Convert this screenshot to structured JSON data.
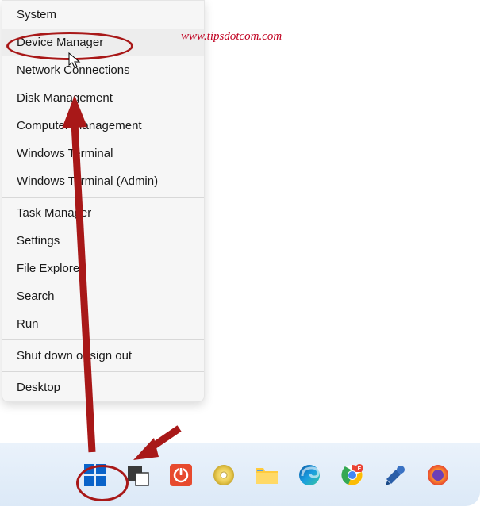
{
  "watermark": "www.tipsdotcom.com",
  "menu": {
    "items": [
      {
        "label": "System"
      },
      {
        "label": "Device Manager",
        "hover": true
      },
      {
        "label": "Network Connections"
      },
      {
        "label": "Disk Management"
      },
      {
        "label": "Computer Management"
      },
      {
        "label": "Windows Terminal"
      },
      {
        "label": "Windows Terminal (Admin)"
      }
    ],
    "items2": [
      {
        "label": "Task Manager"
      },
      {
        "label": "Settings"
      },
      {
        "label": "File Explorer"
      },
      {
        "label": "Search"
      },
      {
        "label": "Run"
      }
    ],
    "items3": [
      {
        "label": "Shut down or sign out"
      }
    ],
    "items4": [
      {
        "label": "Desktop"
      }
    ]
  },
  "taskbar_icons": [
    "start-icon",
    "taskview-icon",
    "shutdown-icon",
    "disc-icon",
    "file-explorer-icon",
    "edge-icon",
    "chrome-icon",
    "tool-icon",
    "firefox-icon"
  ]
}
